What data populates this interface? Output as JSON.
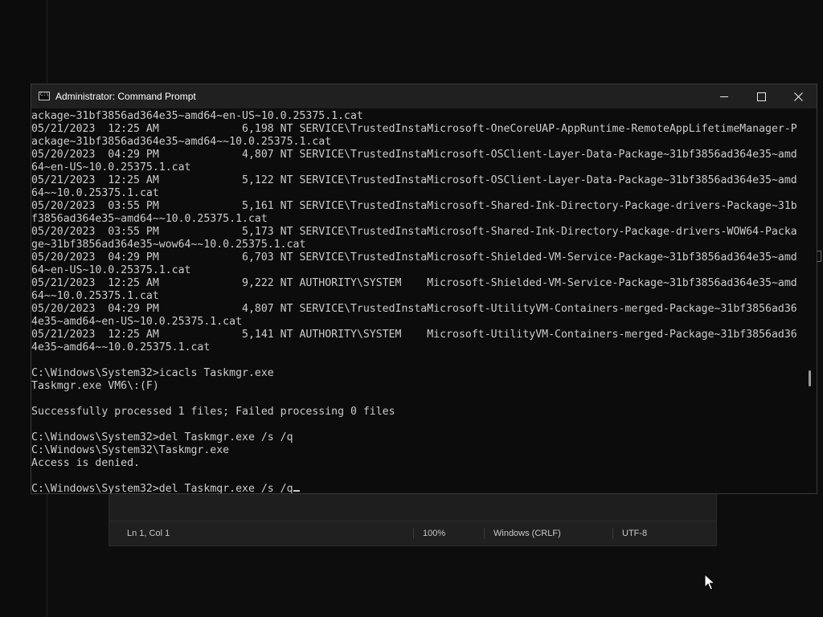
{
  "window": {
    "title": "Administrator: Command Prompt",
    "icon": "cmd-icon",
    "icon_text": "C:\\"
  },
  "console": {
    "lines": [
      "ackage~31bf3856ad364e35~amd64~en-US~10.0.25375.1.cat",
      "05/21/2023  12:25 AM             6,198 NT SERVICE\\TrustedInstaMicrosoft-OneCoreUAP-AppRuntime-RemoteAppLifetimeManager-P",
      "ackage~31bf3856ad364e35~amd64~~10.0.25375.1.cat",
      "05/20/2023  04:29 PM             4,807 NT SERVICE\\TrustedInstaMicrosoft-OSClient-Layer-Data-Package~31bf3856ad364e35~amd",
      "64~en-US~10.0.25375.1.cat",
      "05/21/2023  12:25 AM             5,122 NT SERVICE\\TrustedInstaMicrosoft-OSClient-Layer-Data-Package~31bf3856ad364e35~amd",
      "64~~10.0.25375.1.cat",
      "05/20/2023  03:55 PM             5,161 NT SERVICE\\TrustedInstaMicrosoft-Shared-Ink-Directory-Package-drivers-Package~31b",
      "f3856ad364e35~amd64~~10.0.25375.1.cat",
      "05/20/2023  03:55 PM             5,173 NT SERVICE\\TrustedInstaMicrosoft-Shared-Ink-Directory-Package-drivers-WOW64-Packa",
      "ge~31bf3856ad364e35~wow64~~10.0.25375.1.cat",
      "05/20/2023  04:29 PM             6,703 NT SERVICE\\TrustedInstaMicrosoft-Shielded-VM-Service-Package~31bf3856ad364e35~amd",
      "64~en-US~10.0.25375.1.cat",
      "05/21/2023  12:25 AM             9,222 NT AUTHORITY\\SYSTEM    Microsoft-Shielded-VM-Service-Package~31bf3856ad364e35~amd",
      "64~~10.0.25375.1.cat",
      "05/20/2023  04:29 PM             4,807 NT SERVICE\\TrustedInstaMicrosoft-UtilityVM-Containers-merged-Package~31bf3856ad36",
      "4e35~amd64~en-US~10.0.25375.1.cat",
      "05/21/2023  12:25 AM             5,141 NT AUTHORITY\\SYSTEM    Microsoft-UtilityVM-Containers-merged-Package~31bf3856ad36",
      "4e35~amd64~~10.0.25375.1.cat",
      "",
      "C:\\Windows\\System32>icacls Taskmgr.exe",
      "Taskmgr.exe VM6\\:(F)",
      "",
      "Successfully processed 1 files; Failed processing 0 files",
      "",
      "C:\\Windows\\System32>del Taskmgr.exe /s /q",
      "C:\\Windows\\System32\\Taskmgr.exe",
      "Access is denied.",
      ""
    ],
    "prompt": "C:\\Windows\\System32>",
    "current_input": "del Taskmgr.exe /s /q"
  },
  "notepad_status": {
    "position": "Ln 1, Col 1",
    "zoom": "100%",
    "line_ending": "Windows (CRLF)",
    "encoding": "UTF-8"
  },
  "colors": {
    "console_bg": "#0c0c0c",
    "console_fg": "#cccccc",
    "titlebar_bg": "#202020"
  }
}
